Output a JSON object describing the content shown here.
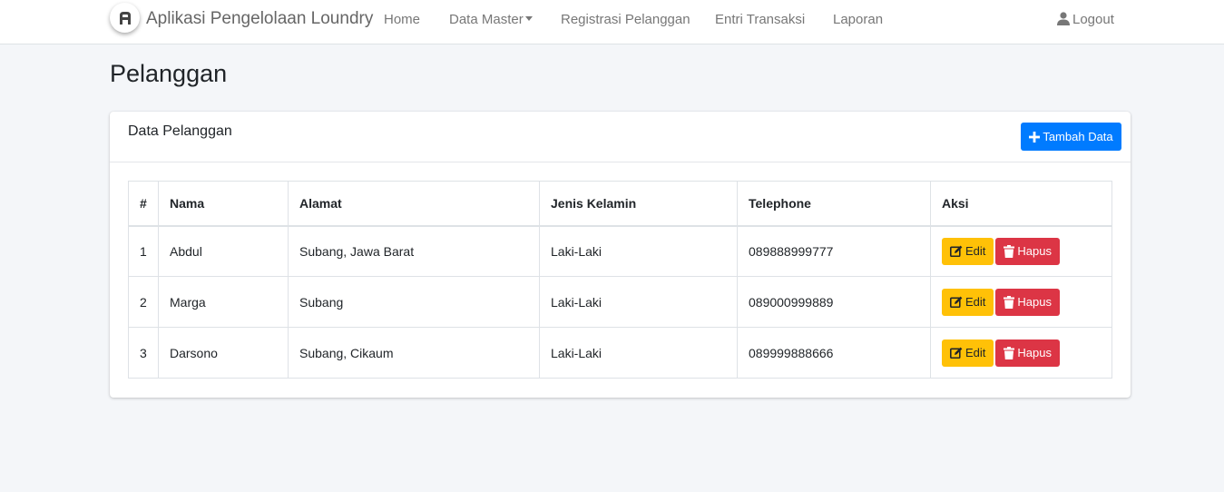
{
  "navbar": {
    "brand": "Aplikasi Pengelolaan Loundry",
    "links": [
      "Home",
      "Data Master",
      "Registrasi Pelanggan",
      "Entri Transaksi",
      "Laporan"
    ],
    "logout": "Logout"
  },
  "page": {
    "title": "Pelanggan"
  },
  "card": {
    "title": "Data Pelanggan",
    "add_button": "Tambah Data"
  },
  "table": {
    "headers": [
      "#",
      "Nama",
      "Alamat",
      "Jenis Kelamin",
      "Telephone",
      "Aksi"
    ],
    "rows": [
      {
        "no": "1",
        "nama": "Abdul",
        "alamat": "Subang, Jawa Barat",
        "jk": "Laki-Laki",
        "telp": "089888999777"
      },
      {
        "no": "2",
        "nama": "Marga",
        "alamat": "Subang",
        "jk": "Laki-Laki",
        "telp": "089000999889"
      },
      {
        "no": "3",
        "nama": "Darsono",
        "alamat": "Subang, Cikaum",
        "jk": "Laki-Laki",
        "telp": "089999888666"
      }
    ],
    "edit_label": "Edit",
    "delete_label": "Hapus"
  },
  "colors": {
    "primary": "#007bff",
    "warning": "#ffc107",
    "danger": "#dc3545",
    "background": "#f4f6f9"
  },
  "icons": {
    "brand": "logo-icon",
    "logout": "user-icon",
    "add": "plus-icon",
    "edit": "edit-icon",
    "delete": "trash-icon"
  }
}
